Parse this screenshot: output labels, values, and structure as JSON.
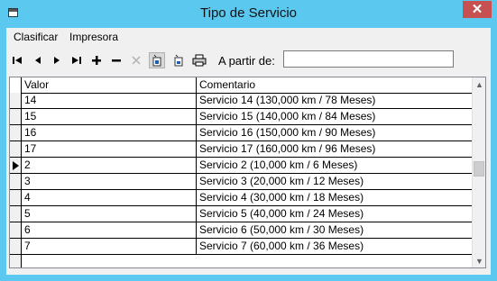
{
  "window": {
    "title": "Tipo de Servicio",
    "close_glyph": "✕"
  },
  "menu": [
    "Clasificar",
    "Impresora"
  ],
  "toolbar": {
    "buttons": [
      {
        "name": "first-record-icon"
      },
      {
        "name": "prev-record-icon"
      },
      {
        "name": "next-record-icon"
      },
      {
        "name": "last-record-icon"
      },
      {
        "name": "add-record-icon"
      },
      {
        "name": "delete-record-icon"
      },
      {
        "name": "cut-icon"
      },
      {
        "name": "filter-icon"
      },
      {
        "name": "sort-icon"
      },
      {
        "name": "print-icon"
      }
    ],
    "apartir_label": "A partir de:",
    "apartir_value": ""
  },
  "grid": {
    "columns": [
      "Valor",
      "Comentario"
    ],
    "rows": [
      {
        "valor": "14",
        "comentario": "Servicio 14 (130,000 km / 78 Meses)",
        "current": false
      },
      {
        "valor": "15",
        "comentario": "Servicio 15 (140,000 km / 84 Meses)",
        "current": false
      },
      {
        "valor": "16",
        "comentario": "Servicio 16 (150,000 km / 90 Meses)",
        "current": false
      },
      {
        "valor": "17",
        "comentario": "Servicio 17 (160,000 km / 96 Meses)",
        "current": false
      },
      {
        "valor": "2",
        "comentario": "Servicio 2 (10,000 km / 6 Meses)",
        "current": true
      },
      {
        "valor": "3",
        "comentario": "Servicio 3 (20,000 km / 12 Meses)",
        "current": false
      },
      {
        "valor": "4",
        "comentario": "Servicio 4 (30,000 km / 18 Meses)",
        "current": false
      },
      {
        "valor": "5",
        "comentario": "Servicio 5 (40,000 km / 24 Meses)",
        "current": false
      },
      {
        "valor": "6",
        "comentario": "Servicio 6 (50,000 km / 30 Meses)",
        "current": false
      },
      {
        "valor": "7",
        "comentario": "Servicio 7 (60,000 km / 36 Meses)",
        "current": false
      }
    ]
  }
}
